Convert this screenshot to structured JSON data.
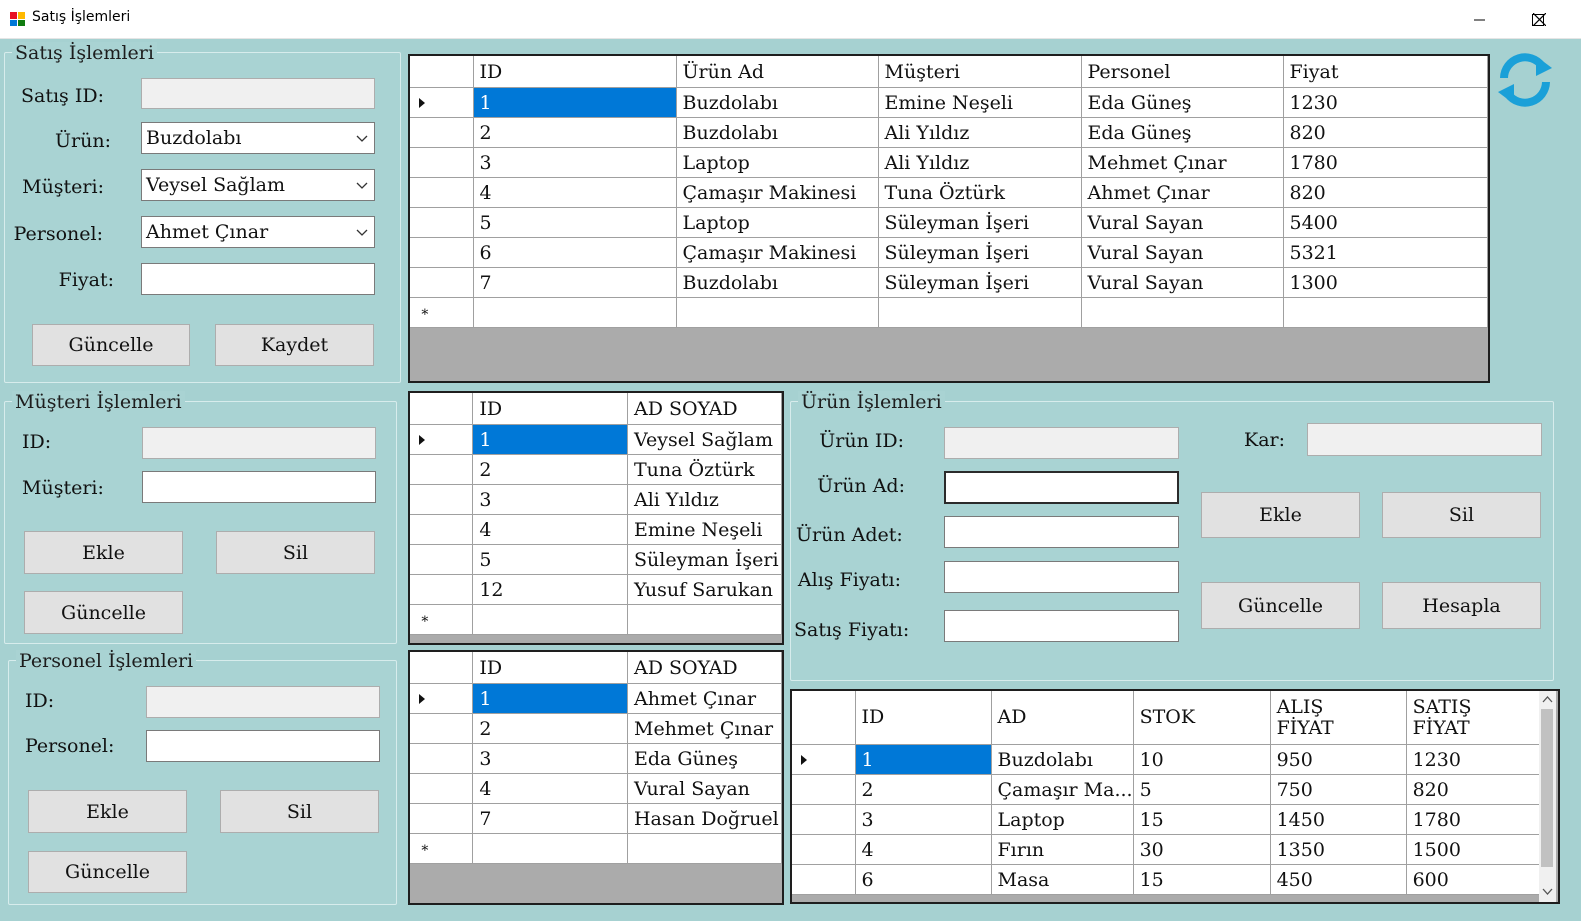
{
  "window": {
    "title": "Satış İşlemleri"
  },
  "refresh_icon_color": "#1aa0d8",
  "accent_color": "#0078d7",
  "sales_group": {
    "title": "Satış İşlemleri",
    "satis_id_label": "Satış ID:",
    "urun_label": "Ürün:",
    "urun_value": "Buzdolabı",
    "musteri_label": "Müşteri:",
    "musteri_value": "Veysel Sağlam",
    "personel_label": "Personel:",
    "personel_value": "Ahmet Çınar",
    "fiyat_label": "Fiyat:",
    "update_button": "Güncelle",
    "save_button": "Kaydet"
  },
  "customer_group": {
    "title": "Müşteri İşlemleri",
    "id_label": "ID:",
    "name_label": "Müşteri:",
    "add_button": "Ekle",
    "delete_button": "Sil",
    "update_button": "Güncelle"
  },
  "staff_group": {
    "title": "Personel İşlemleri",
    "id_label": "ID:",
    "name_label": "Personel:",
    "add_button": "Ekle",
    "delete_button": "Sil",
    "update_button": "Güncelle"
  },
  "product_group": {
    "title": "Ürün İşlemleri",
    "id_label": "Ürün ID:",
    "name_label": "Ürün Ad:",
    "qty_label": "Ürün Adet:",
    "buy_price_label": "Alış Fiyatı:",
    "sell_price_label": "Satış Fiyatı:",
    "profit_label": "Kar:",
    "add_button": "Ekle",
    "delete_button": "Sil",
    "update_button": "Güncelle",
    "calc_button": "Hesapla"
  },
  "sales_grid": {
    "columns": [
      "ID",
      "Ürün Ad",
      "Müşteri",
      "Personel",
      "Fiyat"
    ],
    "rows": [
      [
        "1",
        "Buzdolabı",
        "Emine Neşeli",
        "Eda Güneş",
        "1230"
      ],
      [
        "2",
        "Buzdolabı",
        "Ali Yıldız",
        "Eda Güneş",
        "820"
      ],
      [
        "3",
        "Laptop",
        "Ali Yıldız",
        "Mehmet Çınar",
        "1780"
      ],
      [
        "4",
        "Çamaşır Makinesi",
        "Tuna Öztürk",
        "Ahmet Çınar",
        "820"
      ],
      [
        "5",
        "Laptop",
        "Süleyman İşeri",
        "Vural Sayan",
        "5400"
      ],
      [
        "6",
        "Çamaşır Makinesi",
        "Süleyman İşeri",
        "Vural Sayan",
        "5321"
      ],
      [
        "7",
        "Buzdolabı",
        "Süleyman İşeri",
        "Vural Sayan",
        "1300"
      ]
    ]
  },
  "customer_grid": {
    "columns": [
      "ID",
      "AD SOYAD"
    ],
    "rows": [
      [
        "1",
        "Veysel Sağlam"
      ],
      [
        "2",
        "Tuna Öztürk"
      ],
      [
        "3",
        "Ali Yıldız"
      ],
      [
        "4",
        "Emine Neşeli"
      ],
      [
        "5",
        "Süleyman İşeri"
      ],
      [
        "12",
        "Yusuf Sarukan"
      ]
    ]
  },
  "staff_grid": {
    "columns": [
      "ID",
      "AD SOYAD"
    ],
    "rows": [
      [
        "1",
        "Ahmet Çınar"
      ],
      [
        "2",
        "Mehmet Çınar"
      ],
      [
        "3",
        "Eda Güneş"
      ],
      [
        "4",
        "Vural Sayan"
      ],
      [
        "7",
        "Hasan Doğruel"
      ]
    ]
  },
  "product_grid": {
    "columns": [
      "ID",
      "AD",
      "STOK",
      "ALIŞ\nFİYAT",
      "SATIŞ\nFİYAT"
    ],
    "rows": [
      [
        "1",
        "Buzdolabı",
        "10",
        "950",
        "1230"
      ],
      [
        "2",
        "Çamaşır Ma...",
        "5",
        "750",
        "820"
      ],
      [
        "3",
        "Laptop",
        "15",
        "1450",
        "1780"
      ],
      [
        "4",
        "Fırın",
        "30",
        "1350",
        "1500"
      ],
      [
        "6",
        "Masa",
        "15",
        "450",
        "600"
      ]
    ]
  }
}
